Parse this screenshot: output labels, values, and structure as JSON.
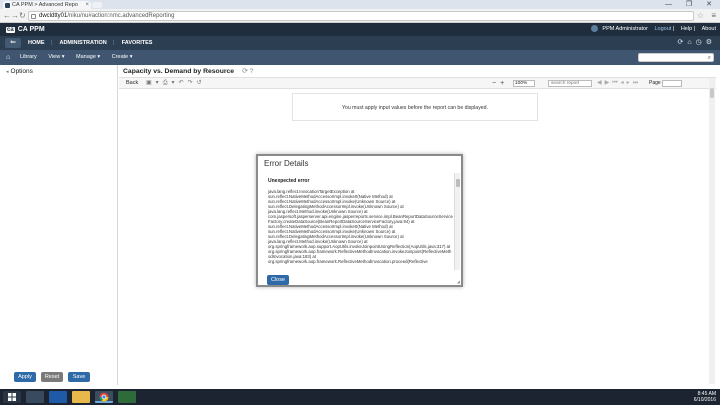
{
  "browser": {
    "tab_title": "CA PPM > Advanced Repo",
    "url_host": "dwcldtty01",
    "url_path": "/niku/nu#action:nmc.advancedReporting",
    "window_controls": "— ❐ ✕"
  },
  "header": {
    "brand": "CA PPM",
    "logo_mark": "ca",
    "user": "PPM Administrator",
    "logout": "Logout",
    "help": "Help",
    "about": "About"
  },
  "nav": {
    "home": "HOME",
    "administration": "ADMINISTRATION",
    "favorites": "FAVORITES"
  },
  "subnav": {
    "library": "Library",
    "view": "View ▾",
    "manage": "Manage ▾",
    "create": "Create ▾"
  },
  "sidebar": {
    "options": "Options",
    "apply": "Apply",
    "reset": "Reset",
    "save": "Save"
  },
  "report": {
    "title": "Capacity vs. Demand by Resource",
    "help": "⟳ ?",
    "back": "Back",
    "zoom": "100%",
    "search_placeholder": "search report",
    "page_label": "Page",
    "notice": "You must apply input values before the report can be displayed."
  },
  "modal": {
    "title": "Error Details",
    "error_heading": "Unexpected error",
    "trace": "java.lang.reflect.InvocationTargetException at\nsun.reflect.NativeMethodAccessorImpl.invoke0(Native Method) at\nsun.reflect.NativeMethodAccessorImpl.invoke(Unknown Source) at\nsun.reflect.DelegatingMethodAccessorImpl.invoke(Unknown Source) at\njava.lang.reflect.Method.invoke(Unknown Source) at\ncom.jaspersoft.jasperserver.api.engine.jasperreports.service.impl.BeanReportDataSourceServiceFactory.createDataSource(BeanReportDataSourceServiceFactory.java:94) at\nsun.reflect.NativeMethodAccessorImpl.invoke0(Native Method) at\nsun.reflect.NativeMethodAccessorImpl.invoke(Unknown Source) at\nsun.reflect.DelegatingMethodAccessorImpl.invoke(Unknown Source) at\njava.lang.reflect.Method.invoke(Unknown Source) at\norg.springframework.aop.support.AopUtils.invokeJoinpointUsingReflection(AopUtils.java:317) at\norg.springframework.aop.framework.ReflectiveMethodInvocation.invokeJoinpoint(ReflectiveMethodInvocation.java:183) at\norg.springframework.aop.framework.ReflectiveMethodInvocation.proceed(Reflective",
    "close": "Close"
  },
  "taskbar": {
    "time": "8:45 AM",
    "date": "6/10/2016"
  }
}
